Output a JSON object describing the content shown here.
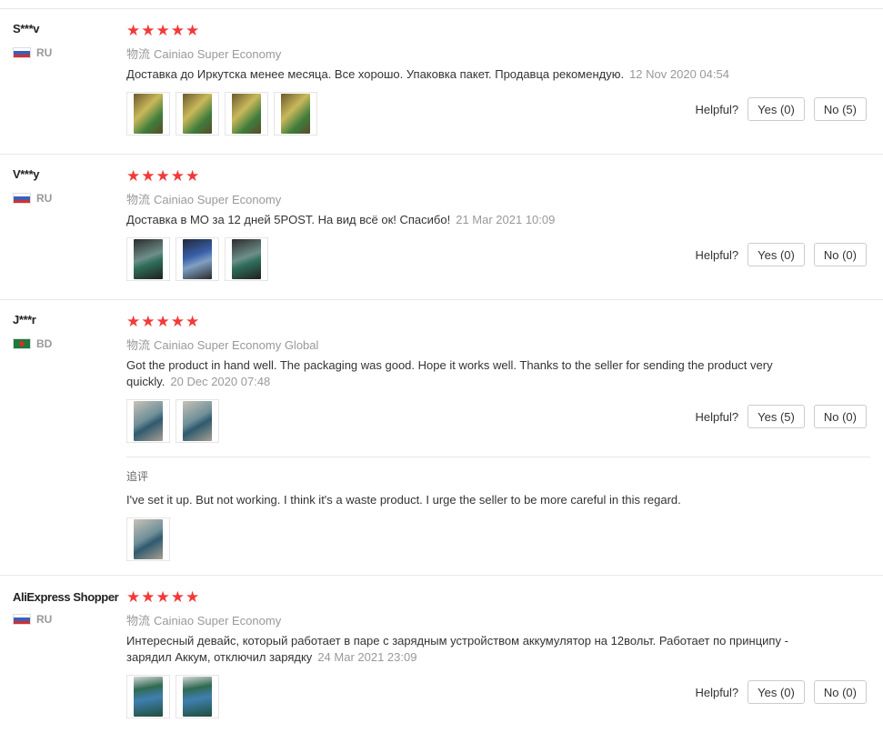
{
  "helpful_label": "Helpful?",
  "reviews": [
    {
      "user": "S***v",
      "country": "RU",
      "stars": "★★★★★",
      "logistics_cn": "物流",
      "logistics": "Cainiao Super Economy",
      "text": "Доставка до Иркутска менее месяца. Все хорошо. Упаковка пакет. Продавца рекомендую.",
      "date": "12 Nov 2020 04:54",
      "thumbnails": 4,
      "yes": "Yes (0)",
      "no": "No (5)"
    },
    {
      "user": "V***y",
      "country": "RU",
      "stars": "★★★★★",
      "logistics_cn": "物流",
      "logistics": "Cainiao Super Economy",
      "text": "Доставка в МО за 12 дней 5POST. На вид всё ок! Спасибо!",
      "date": "21 Mar 2021 10:09",
      "thumbnails": 3,
      "yes": "Yes (0)",
      "no": "No (0)"
    },
    {
      "user": "J***r",
      "country": "BD",
      "stars": "★★★★★",
      "logistics_cn": "物流",
      "logistics": "Cainiao Super Economy Global",
      "text": "Got the product in hand well. The packaging was good. Hope it works well. Thanks to the seller for sending the product very quickly.",
      "date": "20 Dec 2020 07:48",
      "thumbnails": 2,
      "yes": "Yes (5)",
      "no": "No (0)",
      "followup": {
        "label": "追评",
        "text": "I've set it up. But not working. I think it's a waste product. I urge the seller to be more careful in this regard.",
        "thumbnails": 1
      }
    },
    {
      "user": "AliExpress Shopper",
      "country": "RU",
      "stars": "★★★★★",
      "logistics_cn": "物流",
      "logistics": "Cainiao Super Economy",
      "text": "Интересный девайс, который работает в паре с зарядным устройством аккумулятор на 12вольт. Работает по принципу - зарядил Аккум, отключил зарядку",
      "date": "24 Mar 2021 23:09",
      "thumbnails": 2,
      "yes": "Yes (0)",
      "no": "No (0)"
    }
  ]
}
